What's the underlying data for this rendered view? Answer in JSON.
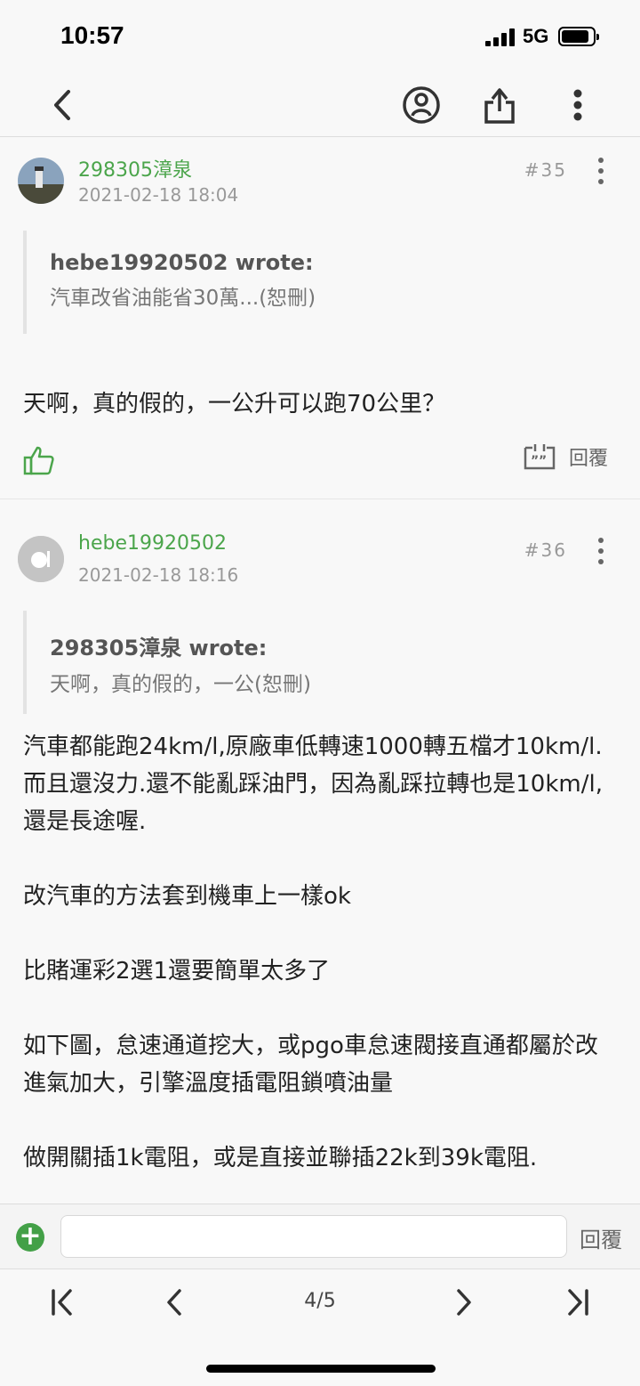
{
  "status": {
    "time": "10:57",
    "network": "5G"
  },
  "posts": [
    {
      "username": "298305漳泉",
      "datetime": "2021-02-18 18:04",
      "floor": "#35",
      "quote_author": "hebe19920502 wrote:",
      "quote_text": "汽車改省油能省30萬...(恕刪)",
      "content": [
        "天啊，真的假的，一公升可以跑70公里？"
      ],
      "reply_label": "回覆"
    },
    {
      "username": "hebe19920502",
      "datetime": "2021-02-18 18:16",
      "floor": "#36",
      "quote_author": "298305漳泉 wrote:",
      "quote_text": "天啊，真的假的，一公(恕刪)",
      "content": [
        "汽車都能跑24km/l,原廠車低轉速1000轉五檔才10km/l.而且還沒力.還不能亂踩油門，因為亂踩拉轉也是10km/l,還是長途喔.",
        "改汽車的方法套到機車上一樣ok",
        "比賭運彩2選1還要簡單太多了",
        "如下圖，怠速通道挖大，或pgo車怠速閥接直通都屬於改進氣加大，引擎溫度插電阻鎖噴油量",
        "做開關插1k電阻，或是直接並聯插22k到39k電阻."
      ]
    }
  ],
  "reply_bar": {
    "input_value": "",
    "send_label": "回覆"
  },
  "pager": {
    "page_indicator": "4/5"
  },
  "colors": {
    "accent_green": "#4ba54b",
    "plus_green": "#43a047"
  }
}
